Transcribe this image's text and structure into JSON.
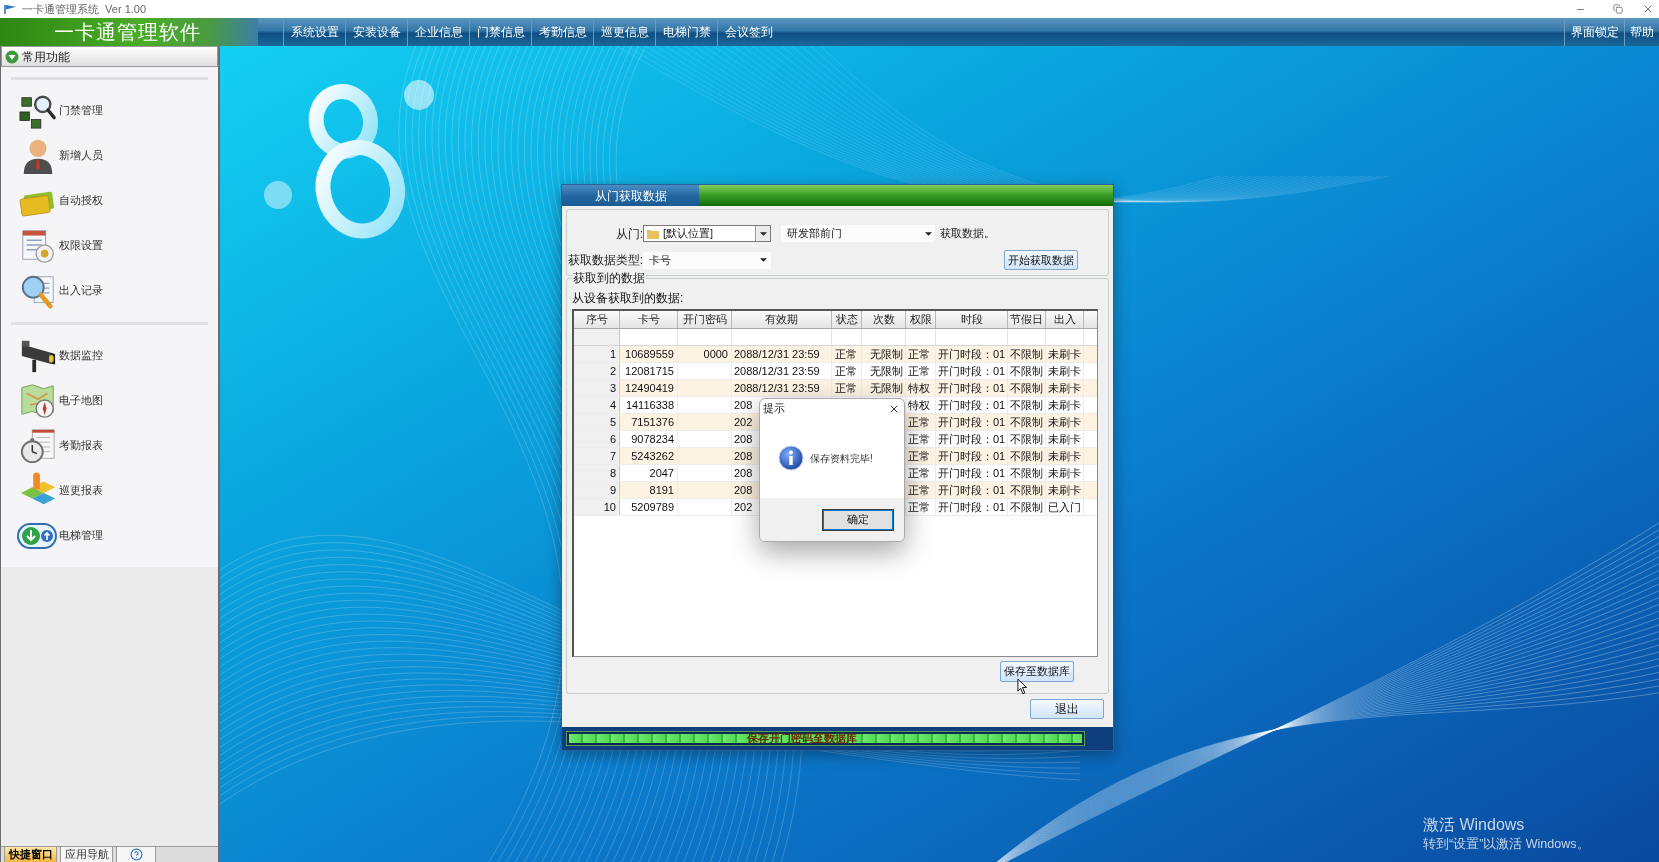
{
  "window": {
    "title": "一卡通管理系统  Ver 1.00"
  },
  "app_title": "一卡通管理软件",
  "menu": [
    "系统设置",
    "安装设备",
    "企业信息",
    "门禁信息",
    "考勤信息",
    "巡更信息",
    "电梯门禁",
    "会议签到"
  ],
  "menu_right": [
    "界面锁定",
    "帮助"
  ],
  "sidebar": {
    "header": "常用功能",
    "expanded": true,
    "groups": [
      [
        "门禁管理",
        "新增人员",
        "自动授权",
        "权限设置",
        "出入记录"
      ],
      [
        "数据监控",
        "电子地图",
        "考勤报表",
        "巡更报表",
        "电梯管理"
      ]
    ],
    "tabs": [
      {
        "label": "快捷窗口",
        "selected": true
      },
      {
        "label": "应用导航",
        "selected": false
      }
    ]
  },
  "fetch_dialog": {
    "title": "从门获取数据",
    "from_label": "从门:",
    "location": "[默认位置]",
    "door": "研发部前门",
    "from_suffix": "获取数据。",
    "type_label": "获取数据类型:",
    "data_type": "卡号",
    "start_button": "开始获取数据",
    "result_group": "获取到的数据",
    "result_caption": "从设备获取到的数据:",
    "table": {
      "columns": [
        "序号",
        "卡号",
        "开门密码",
        "有效期",
        "状态",
        "次数",
        "权限",
        "时段",
        "节假日",
        "出入"
      ],
      "rows": [
        [
          "1",
          "10689559",
          "0000",
          "2088/12/31 23:59",
          "正常",
          "无限制",
          "正常",
          "开门时段：01",
          "不限制",
          "未刷卡"
        ],
        [
          "2",
          "12081715",
          null,
          "2088/12/31 23:59",
          "正常",
          "无限制",
          "正常",
          "开门时段：01",
          "不限制",
          "未刷卡"
        ],
        [
          "3",
          "12490419",
          null,
          "2088/12/31 23:59",
          "正常",
          "无限制",
          "特权",
          "开门时段：01",
          "不限制",
          "未刷卡"
        ],
        [
          "4",
          "14116338",
          null,
          "208",
          null,
          null,
          "特权",
          "开门时段：01",
          "不限制",
          "未刷卡"
        ],
        [
          "5",
          "7151376",
          null,
          "202",
          null,
          null,
          "正常",
          "开门时段：01",
          "不限制",
          "未刷卡"
        ],
        [
          "6",
          "9078234",
          null,
          "208",
          null,
          null,
          "正常",
          "开门时段：01",
          "不限制",
          "未刷卡"
        ],
        [
          "7",
          "5243262",
          null,
          "208",
          null,
          null,
          "正常",
          "开门时段：01",
          "不限制",
          "未刷卡"
        ],
        [
          "8",
          "2047",
          null,
          "208",
          null,
          null,
          "正常",
          "开门时段：01",
          "不限制",
          "未刷卡"
        ],
        [
          "9",
          "8191",
          null,
          "208",
          null,
          null,
          "正常",
          "开门时段：01",
          "不限制",
          "未刷卡"
        ],
        [
          "10",
          "5209789",
          null,
          "202",
          null,
          null,
          "正常",
          "开门时段：01",
          "不限制",
          "已入门"
        ]
      ]
    },
    "save_button": "保存至数据库",
    "exit_button": "退出",
    "progress": {
      "level": 1,
      "text": "保存开门密码至数据库"
    }
  },
  "message_box": {
    "title": "提示",
    "message": "保存资料完毕!",
    "ok_button": "确定"
  },
  "activation_notice": {
    "title": "激活 Windows",
    "message": "转到“设置”以激活 Windows。"
  }
}
